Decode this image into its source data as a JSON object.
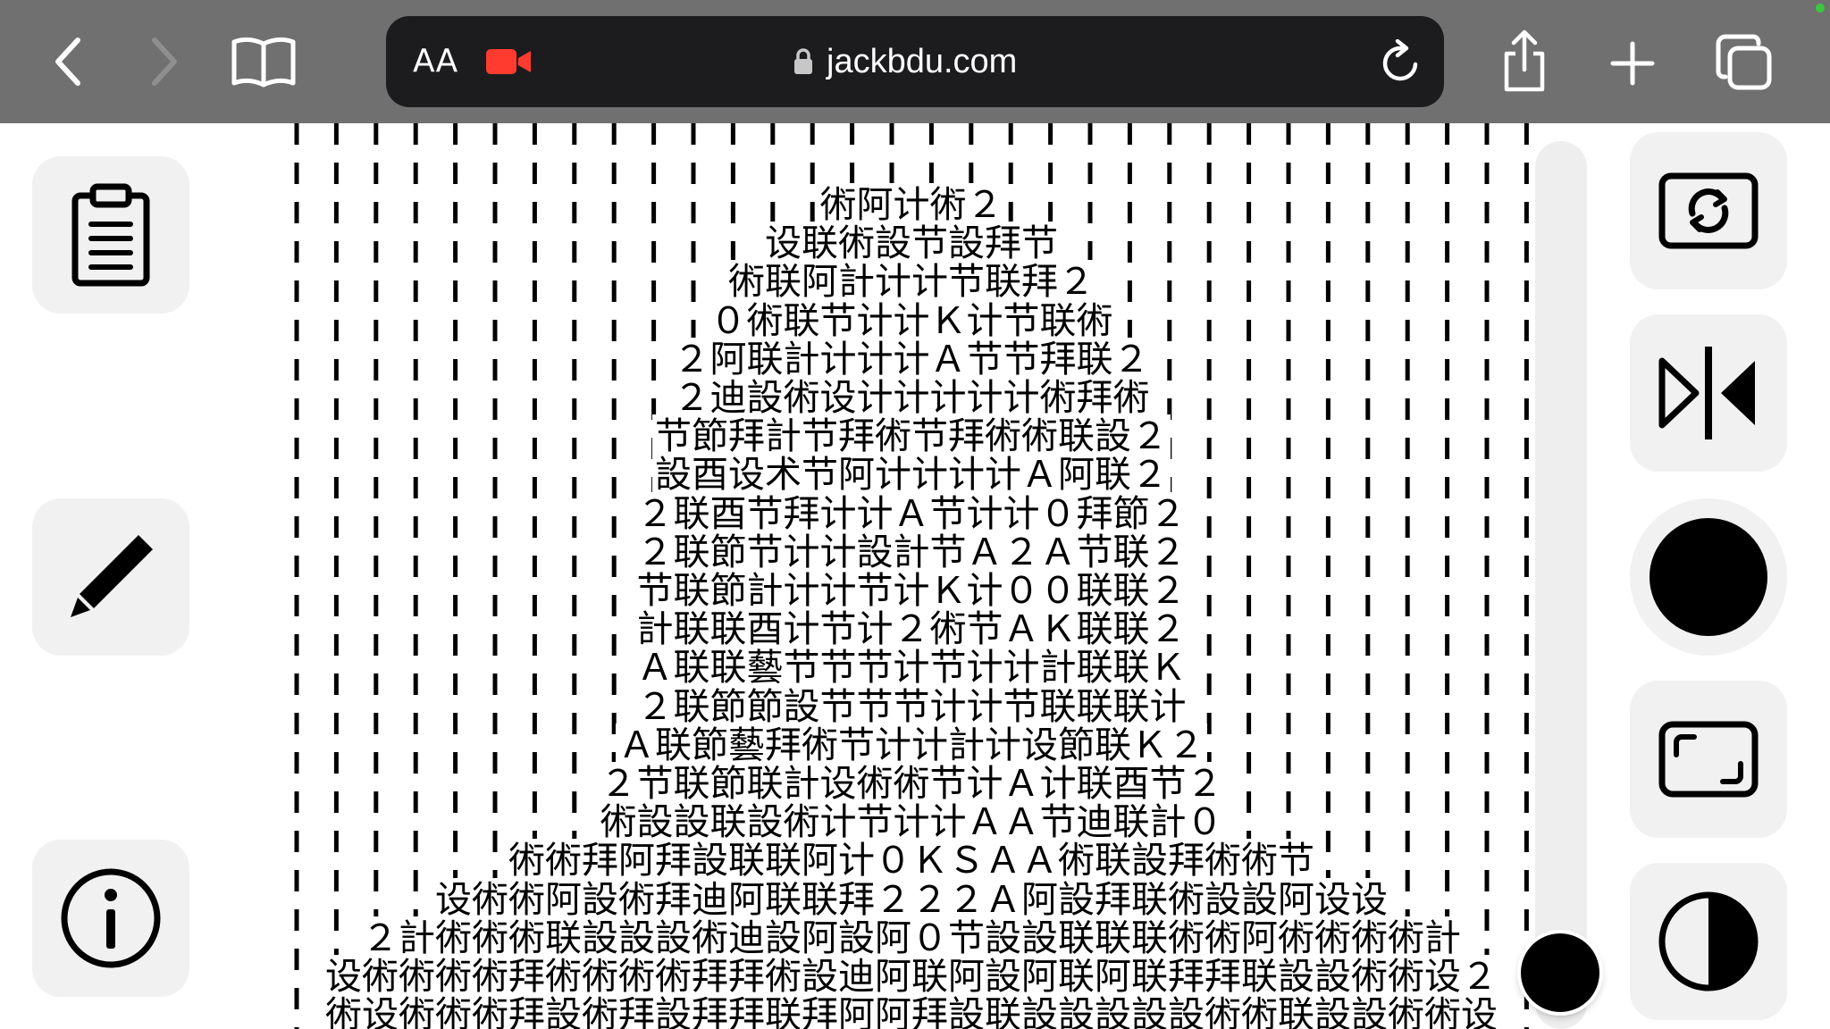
{
  "browser": {
    "text_size_label": "AA",
    "url": "jackbdu.com",
    "icons": {
      "back": "chevron-left-icon",
      "forward": "chevron-right-icon",
      "bookmarks": "book-icon",
      "recording": "video-camera-icon",
      "lock": "lock-icon",
      "reload": "reload-icon",
      "share": "share-icon",
      "new_tab": "plus-icon",
      "tabs": "tabs-icon"
    },
    "colors": {
      "toolbar": "#707070",
      "address_bar": "#1c1c1e",
      "recording": "#ff3b30"
    }
  },
  "art": {
    "rows": [
      "術阿计術２",
      "设联術設节設拜节",
      "術联阿計计计节联拜２",
      "０術联节计计Ｋ计节联術",
      "２阿联計计计计Ａ节节拜联２",
      "２迪設術设计计计计计術拜術",
      "节節拜計节拜術节拜術術联設２",
      "設酉设术节阿计计计计Ａ阿联２",
      "２联酉节拜计计Ａ节计计０拜節２",
      "２联節节计计設計节Ａ２Ａ节联２",
      "节联節計计计节计Ｋ计００联联２",
      "計联联酉计节计２術节ＡＫ联联２",
      "Ａ联联藝节节节计节计计計联联Ｋ",
      "２联節節設节节节计计节联联联计",
      "Ａ联節藝拜術节计计計计设節联Ｋ２",
      "２节联節联計设術術节计Ａ计联酉节２",
      "術設設联設術计节计计ＡＡ节迪联計０",
      "術術拜阿拜設联联阿计０ＫＳＡＡ術联設拜術術节",
      "设術術阿設術拜迪阿联联拜２２２Ａ阿設拜联術設設阿设设",
      "２計術術術联設設設術迪設阿設阿０节設設联联联術術阿術術術術計",
      "设術術術術拜術術術術拜拜術設迪阿联阿設阿联阿联拜拜联設設術術设２",
      "術设術術術拜設術拜設拜拜联拜阿阿拜設联設設設設設術術联設設術術设"
    ],
    "background_pattern": "dashed-vertical-lines"
  },
  "sidebar_left": {
    "icons": [
      "clipboard-icon",
      "pencil-icon",
      "info-icon"
    ]
  },
  "sidebar_right": {
    "icons": [
      "rotate-camera-icon",
      "mirror-flip-icon",
      "record-circle-icon",
      "aspect-ratio-icon",
      "contrast-icon"
    ]
  }
}
